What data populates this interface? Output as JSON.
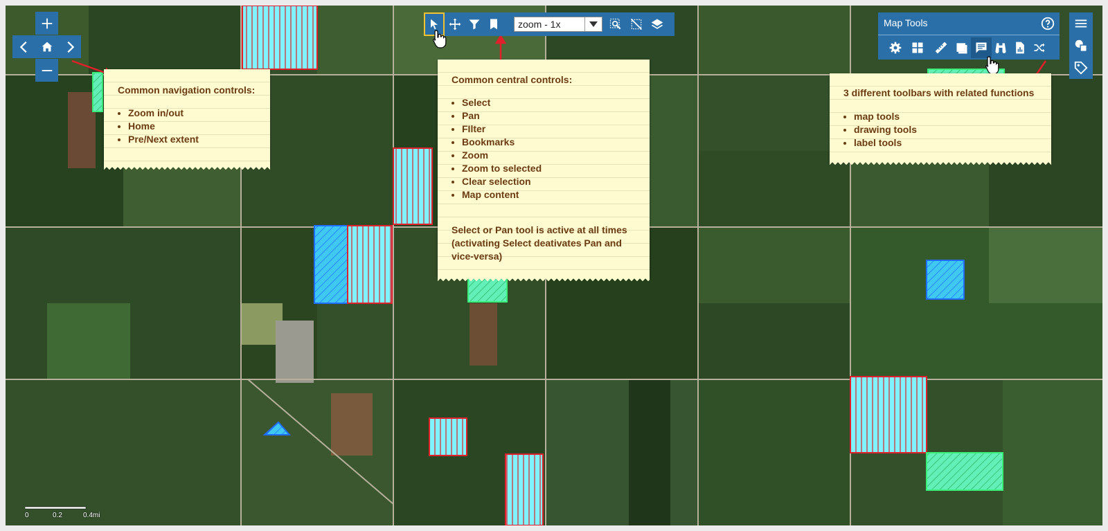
{
  "navigation": {
    "zoom_in": "zoom-in",
    "zoom_out": "zoom-out",
    "home": "home",
    "previous_extent": "previous-extent",
    "next_extent": "next-extent"
  },
  "central_toolbar": {
    "tools": [
      "select",
      "pan",
      "filter",
      "bookmarks",
      "zoom-to-selected",
      "clear-selection",
      "map-content"
    ],
    "active_tool": "select",
    "zoom_value": "zoom - 1x"
  },
  "map_tools_panel": {
    "title": "Map Tools",
    "tools": [
      "settings",
      "layout",
      "measure",
      "shading",
      "comment",
      "binoculars",
      "report",
      "shuffle"
    ],
    "active_tool": "comment"
  },
  "side_toolbar": {
    "items": [
      "menu",
      "drawing-tools",
      "label-tools"
    ]
  },
  "notes": {
    "navigation": {
      "heading": "Common navigation controls:",
      "items": [
        "Zoom in/out",
        "Home",
        "Pre/Next extent"
      ]
    },
    "central": {
      "heading": "Common central controls:",
      "items": [
        "Select",
        "Pan",
        "FIlter",
        "Bookmarks",
        "Zoom",
        "Zoom to selected",
        "Clear selection",
        "Map content"
      ],
      "footer": "Select or Pan tool is active at all times (activating Select deativates Pan and vice-versa)"
    },
    "toolbars": {
      "heading": "3 different toolbars with related functions",
      "items": [
        "map tools",
        "drawing tools",
        "label tools"
      ]
    }
  },
  "scale_bar": {
    "labels": [
      "0",
      "0.2",
      "0.4mi"
    ]
  },
  "colors": {
    "toolbar_blue": "#2a6fa8",
    "note_yellow": "#fffbd0",
    "note_text": "#6b3b12",
    "parcel_fill": "#7ff3ff",
    "parcel_red": "#e0202a",
    "parcel_blue": "#1f6cff",
    "parcel_green": "#3af07a"
  }
}
